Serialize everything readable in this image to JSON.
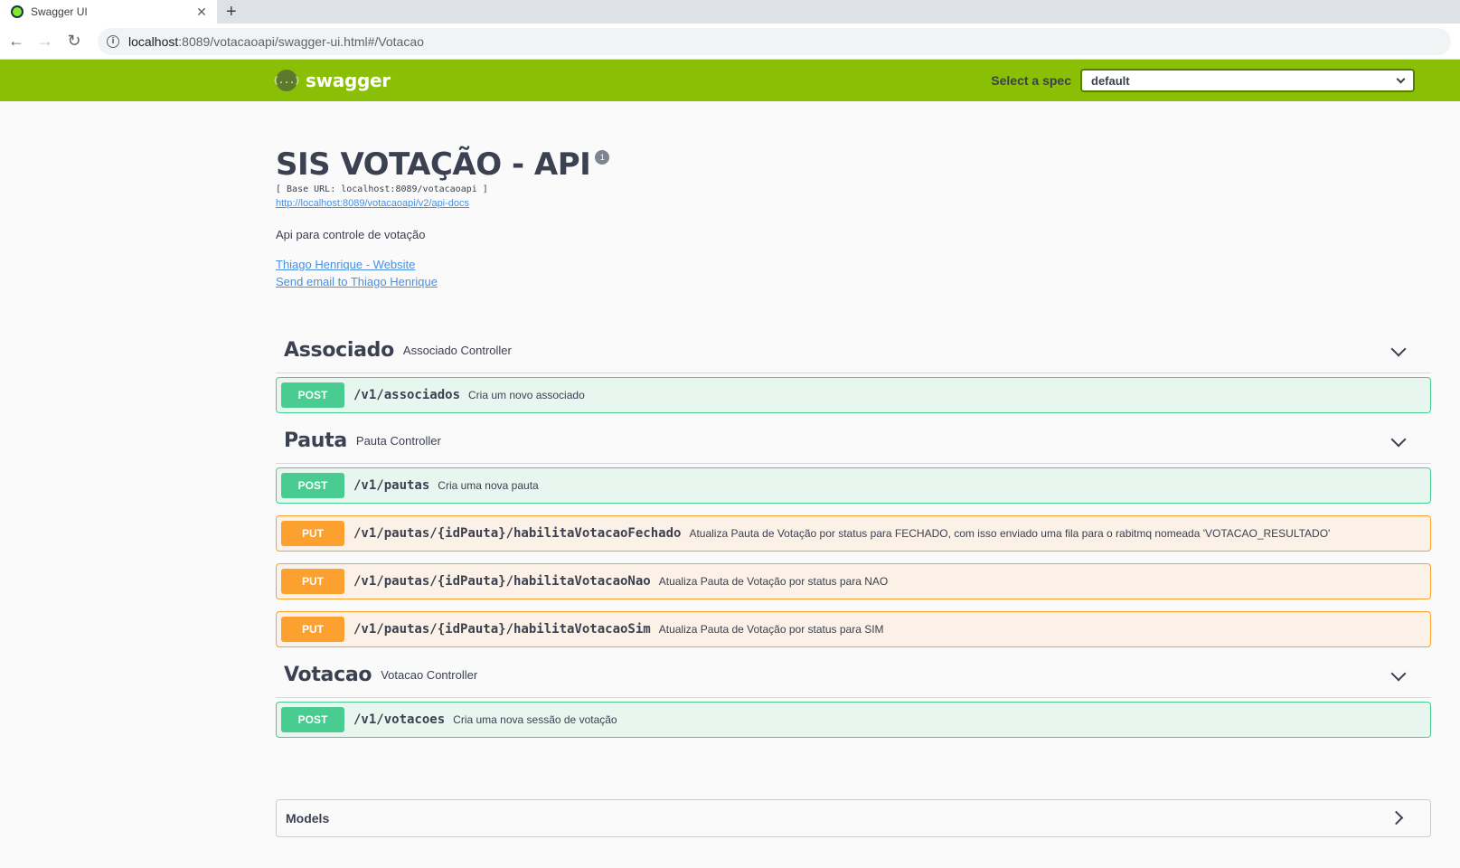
{
  "browser": {
    "tab_title": "Swagger UI",
    "tab_close": "✕",
    "new_tab": "+",
    "url_host": "localhost",
    "url_rest": ":8089/votacaoapi/swagger-ui.html#/Votacao",
    "info_icon": "i"
  },
  "topbar": {
    "logo_mark": "{...}",
    "logo_text": "swagger",
    "spec_label": "Select a spec",
    "spec_value": "default"
  },
  "info": {
    "title": "SIS VOTAÇÃO - API",
    "version_badge": "1",
    "base_url": "[ Base URL: localhost:8089/votacaoapi ]",
    "api_docs_link": "http://localhost:8089/votacaoapi/v2/api-docs",
    "description": "Api para controle de votação",
    "contact_website": "Thiago Henrique - Website",
    "contact_email": "Send email to Thiago Henrique"
  },
  "tags": [
    {
      "name": "Associado",
      "description": "Associado Controller",
      "ops": [
        {
          "method": "POST",
          "path": "/v1/associados",
          "summary": "Cria um novo associado"
        }
      ]
    },
    {
      "name": "Pauta",
      "description": "Pauta Controller",
      "ops": [
        {
          "method": "POST",
          "path": "/v1/pautas",
          "summary": "Cria uma nova pauta"
        },
        {
          "method": "PUT",
          "path": "/v1/pautas/{idPauta}/habilitaVotacaoFechado",
          "summary": "Atualiza Pauta de Votação por status para FECHADO, com isso enviado uma fila para o rabitmq nomeada 'VOTACAO_RESULTADO'"
        },
        {
          "method": "PUT",
          "path": "/v1/pautas/{idPauta}/habilitaVotacaoNao",
          "summary": "Atualiza Pauta de Votação por status para NAO"
        },
        {
          "method": "PUT",
          "path": "/v1/pautas/{idPauta}/habilitaVotacaoSim",
          "summary": "Atualiza Pauta de Votação por status para SIM"
        }
      ]
    },
    {
      "name": "Votacao",
      "description": "Votacao Controller",
      "ops": [
        {
          "method": "POST",
          "path": "/v1/votacoes",
          "summary": "Cria uma nova sessão de votação"
        }
      ]
    }
  ],
  "models": {
    "title": "Models"
  },
  "colors": {
    "topbar": "#89bf04",
    "post": "#49cc90",
    "put": "#fca130",
    "link": "#4990e2"
  }
}
